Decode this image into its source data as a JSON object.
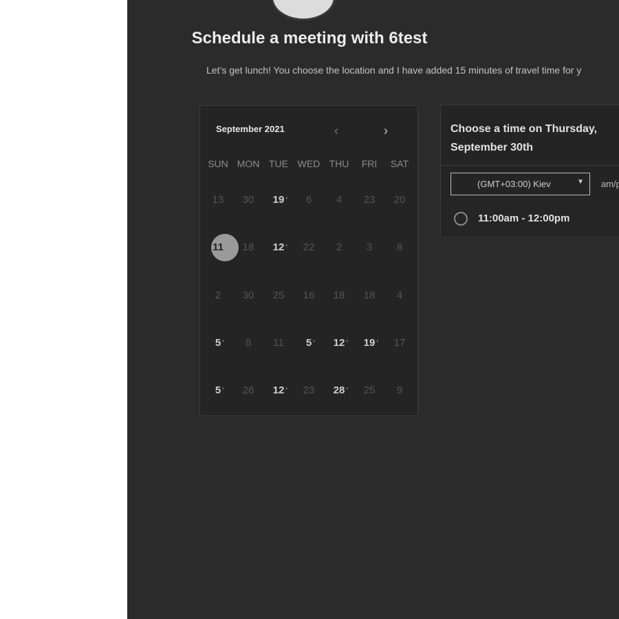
{
  "header": {
    "title": "Schedule a meeting with 6test",
    "subtitle": "Let’s get lunch! You choose the location and I have added 15 minutes of travel time for y"
  },
  "calendar": {
    "month_label": "September 2021",
    "prev_icon": "‹",
    "next_icon": "›",
    "weekdays": [
      "SUN",
      "MON",
      "TUE",
      "WED",
      "THU",
      "FRI",
      "SAT"
    ],
    "weeks": [
      [
        {
          "n": "13",
          "s": "dim"
        },
        {
          "n": "30",
          "s": "dim"
        },
        {
          "n": "19",
          "s": "avail"
        },
        {
          "n": "6",
          "s": "dim"
        },
        {
          "n": "4",
          "s": "dim"
        },
        {
          "n": "23",
          "s": "dim"
        },
        {
          "n": "20",
          "s": "dim"
        }
      ],
      [
        {
          "n": "11",
          "s": "sel"
        },
        {
          "n": "18",
          "s": "dim"
        },
        {
          "n": "12",
          "s": "avail"
        },
        {
          "n": "22",
          "s": "dim"
        },
        {
          "n": "2",
          "s": "dim"
        },
        {
          "n": "3",
          "s": "dim"
        },
        {
          "n": "8",
          "s": "dim"
        }
      ],
      [
        {
          "n": "2",
          "s": "dim"
        },
        {
          "n": "30",
          "s": "dim"
        },
        {
          "n": "25",
          "s": "dim"
        },
        {
          "n": "16",
          "s": "dim"
        },
        {
          "n": "18",
          "s": "dim"
        },
        {
          "n": "18",
          "s": "dim"
        },
        {
          "n": "4",
          "s": "dim"
        }
      ],
      [
        {
          "n": "5",
          "s": "avail"
        },
        {
          "n": "8",
          "s": "dim"
        },
        {
          "n": "11",
          "s": "dim"
        },
        {
          "n": "5",
          "s": "avail"
        },
        {
          "n": "12",
          "s": "avail"
        },
        {
          "n": "19",
          "s": "avail"
        },
        {
          "n": "17",
          "s": "dim"
        }
      ],
      [
        {
          "n": "5",
          "s": "avail"
        },
        {
          "n": "26",
          "s": "dim"
        },
        {
          "n": "12",
          "s": "avail"
        },
        {
          "n": "23",
          "s": "dim"
        },
        {
          "n": "28",
          "s": "avail"
        },
        {
          "n": "25",
          "s": "dim"
        },
        {
          "n": "9",
          "s": "dim"
        }
      ]
    ]
  },
  "panel": {
    "heading": "Choose a time on Thursday, September 30th",
    "timezone": "(GMT+03:00) Kiev",
    "format_label": "am/pm",
    "slot": "11:00am - 12:00pm"
  }
}
